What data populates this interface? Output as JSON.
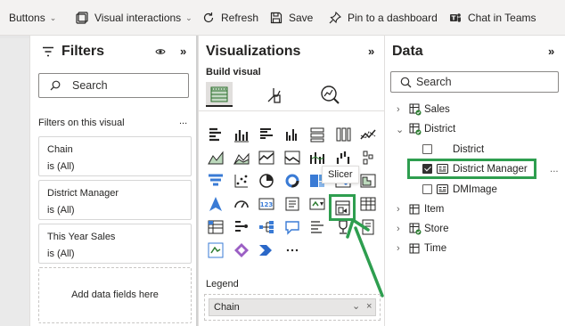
{
  "toolbar": {
    "buttons_label": "Buttons",
    "visual_interactions_label": "Visual interactions",
    "refresh_label": "Refresh",
    "save_label": "Save",
    "pin_label": "Pin to a dashboard",
    "chat_label": "Chat in Teams"
  },
  "filters": {
    "title": "Filters",
    "search_placeholder": "Search",
    "section_label": "Filters on this visual",
    "section_more": "...",
    "cards": [
      {
        "name": "Chain",
        "value": "is (All)"
      },
      {
        "name": "District Manager",
        "value": "is (All)"
      },
      {
        "name": "This Year Sales",
        "value": "is (All)"
      }
    ],
    "add_fields_label": "Add data fields here"
  },
  "visualizations": {
    "title": "Visualizations",
    "build_visual_label": "Build visual",
    "more_label": "...",
    "tooltip_label": "Slicer",
    "legend_label": "Legend",
    "legend_field": "Chain",
    "accent": "#2e9e4f"
  },
  "data": {
    "title": "Data",
    "search_placeholder": "Search",
    "tables": {
      "sales": "Sales",
      "district": "District",
      "item": "Item",
      "store": "Store",
      "time": "Time"
    },
    "fields": {
      "district": "District",
      "district_manager": "District Manager",
      "dmimage": "DMImage"
    },
    "more_label": "..."
  }
}
